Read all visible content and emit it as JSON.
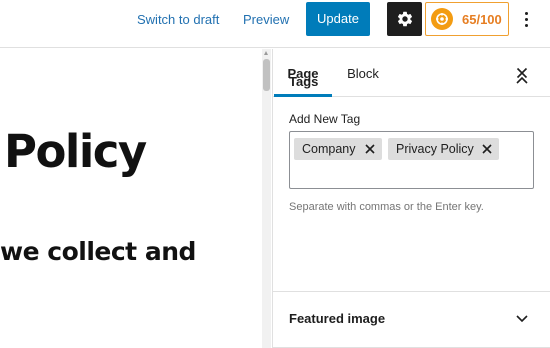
{
  "toolbar": {
    "switch_to_draft": "Switch to draft",
    "preview": "Preview",
    "update": "Update",
    "score": "65/100"
  },
  "editor": {
    "heading": "Policy",
    "paragraph": "we collect and"
  },
  "sidebar": {
    "tabs": [
      "Page",
      "Block"
    ],
    "tags_panel": {
      "title": "Tags",
      "add_new_label": "Add New Tag",
      "tags": [
        "Company",
        "Privacy Policy"
      ],
      "help_text": "Separate with commas or the Enter key."
    },
    "featured_image_panel": {
      "title": "Featured image"
    }
  },
  "colors": {
    "accent": "#007cba",
    "link": "#2271b1",
    "score_orange": "#e67e22"
  }
}
